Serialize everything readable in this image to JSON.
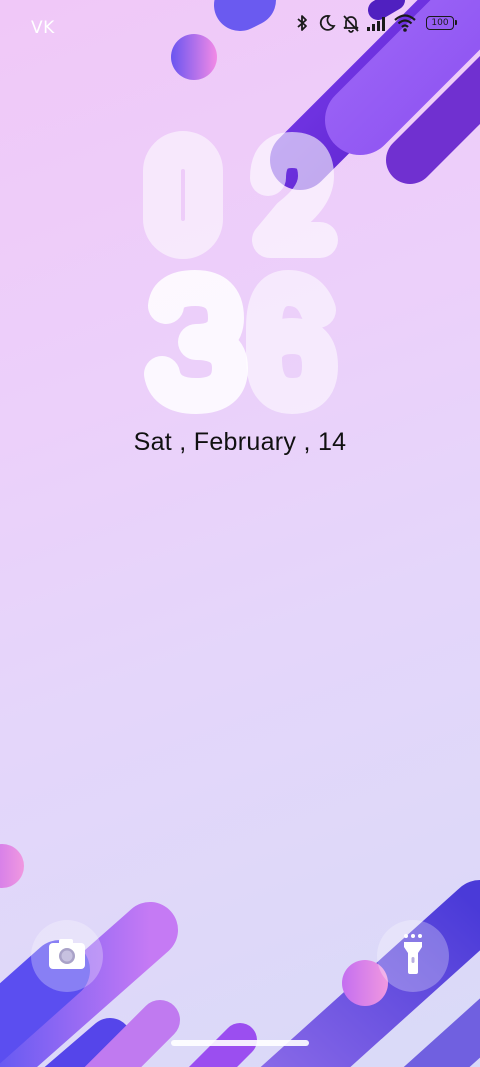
{
  "status_bar": {
    "carrier": "VK",
    "battery_level": "100",
    "icons": [
      "bluetooth-icon",
      "moon-icon",
      "bell-off-icon",
      "signal-icon",
      "wifi-icon",
      "battery-icon"
    ]
  },
  "clock": {
    "hours": "02",
    "minutes": "36"
  },
  "date": {
    "text": "Sat , February , 14"
  },
  "shortcuts": {
    "left_icon": "camera-icon",
    "right_icon": "flashlight-icon"
  },
  "colors": {
    "background_top": "#f0c8f8",
    "background_bottom": "#d9daf8",
    "accent_purple": "#6a2ad8",
    "accent_violet": "#9b5cf6",
    "accent_blue": "#5a4ee8",
    "accent_pink": "#e28ef0"
  }
}
